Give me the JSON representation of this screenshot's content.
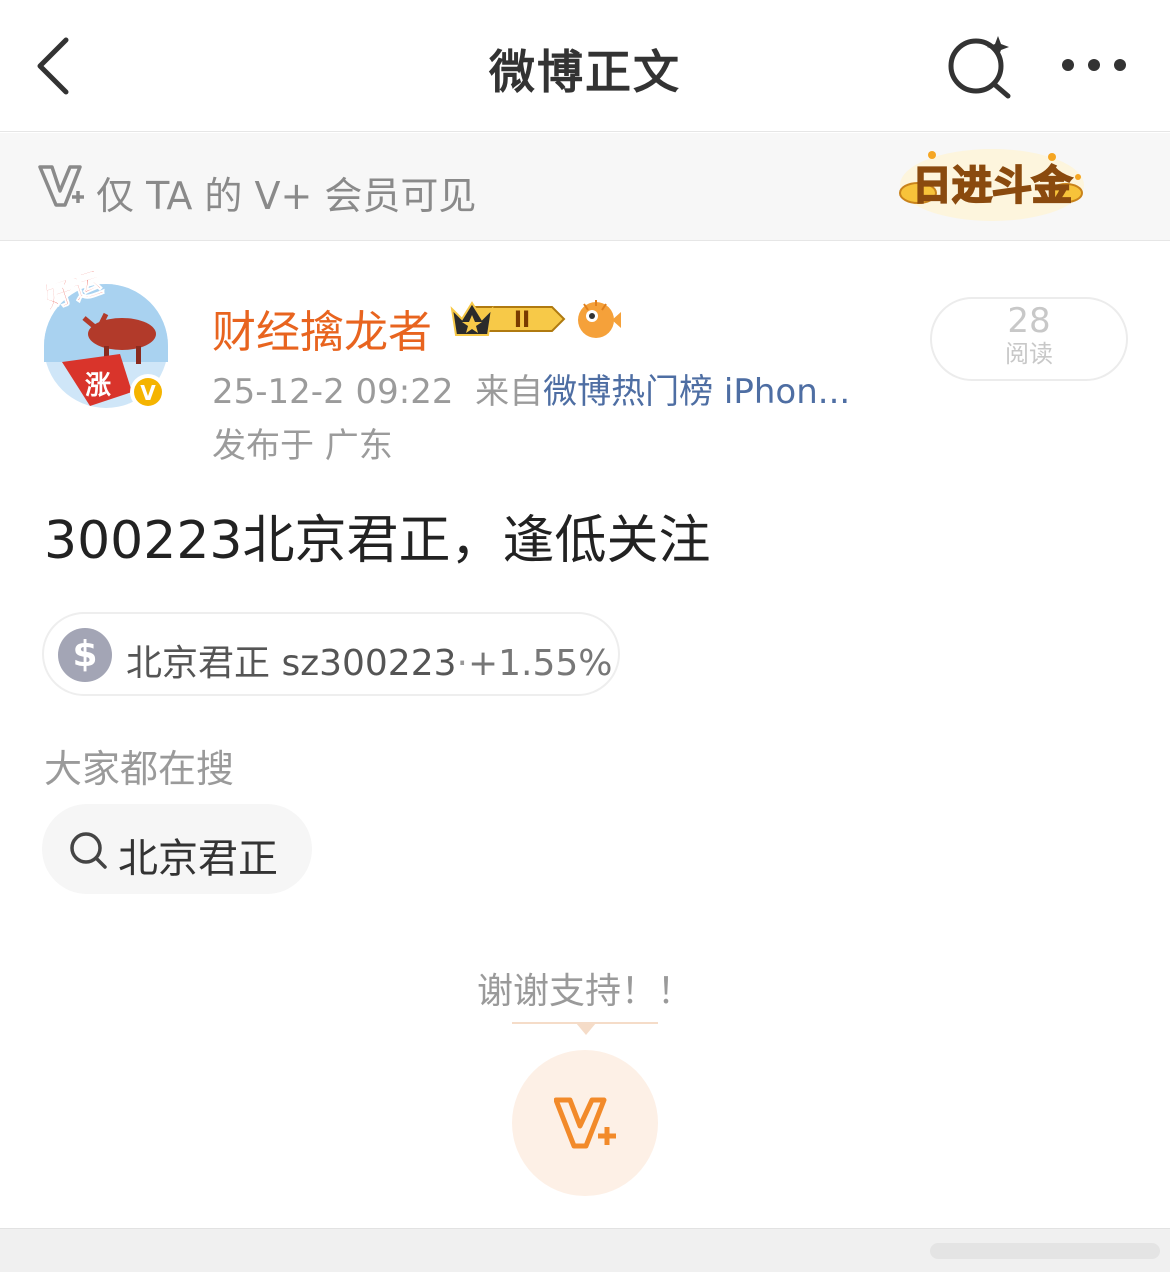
{
  "header": {
    "title": "微博正文"
  },
  "vplus_bar": {
    "text": "仅 TA 的 V+ 会员可见",
    "sticker_text": "日进斗金"
  },
  "post": {
    "author": "财经擒龙者",
    "timestamp": "25-12-2 09:22",
    "source_prefix": "来自",
    "source": "微博热门榜 iPhon...",
    "location": "发布于 广东",
    "read_count": "28",
    "read_label": "阅读",
    "text": "300223北京君正，逢低关注",
    "avatar_caption_top": "好运",
    "avatar_caption_bottom": "涨",
    "verified_mark": "V"
  },
  "stock": {
    "name": "北京君正 sz300223",
    "separator": "·",
    "change": "+1.55%",
    "icon_symbol": "$"
  },
  "trending": {
    "heading": "大家都在搜",
    "items": [
      {
        "label": "北京君正"
      }
    ]
  },
  "support": {
    "thanks_text": "谢谢支持！！"
  },
  "colors": {
    "brand_orange": "#e8641f",
    "link_blue": "#4e6ea3",
    "muted_text": "#9b9b9b",
    "vplus_bg": "#fdf0e6",
    "vplus_icon": "#f28a2a"
  }
}
